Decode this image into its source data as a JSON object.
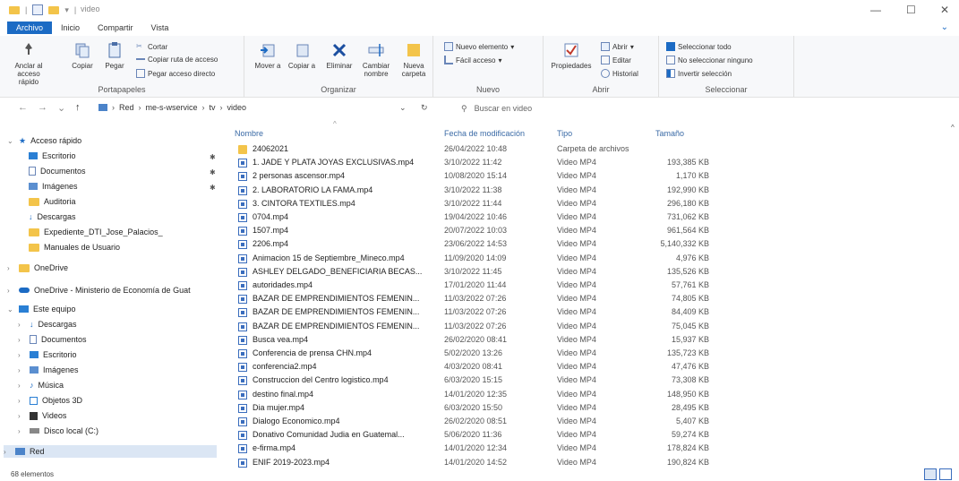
{
  "window": {
    "title": "video",
    "minimize": "—",
    "maximize": "☐",
    "close": "✕"
  },
  "tabs": [
    "Archivo",
    "Inicio",
    "Compartir",
    "Vista"
  ],
  "ribbon": {
    "portapapeles": {
      "label": "Portapapeles",
      "anclar": "Anclar al acceso rápido",
      "copiar": "Copiar",
      "pegar": "Pegar",
      "cortar": "Cortar",
      "copiar_ruta": "Copiar ruta de acceso",
      "pegar_acceso": "Pegar acceso directo"
    },
    "organizar": {
      "label": "Organizar",
      "mover": "Mover a",
      "copiar_a": "Copiar a",
      "eliminar": "Eliminar",
      "cambiar": "Cambiar nombre",
      "nueva": "Nueva carpeta"
    },
    "nuevo": {
      "label": "Nuevo",
      "nuevo_elemento": "Nuevo elemento",
      "facil_acceso": "Fácil acceso"
    },
    "abrir": {
      "label": "Abrir",
      "propiedades": "Propiedades",
      "abrir": "Abrir",
      "editar": "Editar",
      "historial": "Historial"
    },
    "seleccionar": {
      "label": "Seleccionar",
      "todo": "Seleccionar todo",
      "ninguno": "No seleccionar ninguno",
      "invertir": "Invertir selección"
    }
  },
  "address": {
    "crumbs": [
      "Red",
      "me-s-wservice",
      "tv",
      "video"
    ],
    "search_placeholder": "Buscar en video"
  },
  "nav": {
    "quick_access": "Acceso rápido",
    "quick_items": [
      "Escritorio",
      "Documentos",
      "Imágenes",
      "Auditoria",
      "Descargas",
      "Expediente_DTI_Jose_Palacios_",
      "Manuales de Usuario"
    ],
    "onedrive": "OneDrive",
    "onedrive_org": "OneDrive - Ministerio de Economía de Guat",
    "this_pc": "Este equipo",
    "pc_items": [
      "Descargas",
      "Documentos",
      "Escritorio",
      "Imágenes",
      "Música",
      "Objetos 3D",
      "Videos",
      "Disco local (C:)"
    ],
    "red": "Red"
  },
  "columns": {
    "name": "Nombre",
    "date": "Fecha de modificación",
    "type": "Tipo",
    "size": "Tamaño"
  },
  "files": [
    {
      "icon": "folder",
      "name": "24062021",
      "date": "26/04/2022 10:48",
      "type": "Carpeta de archivos",
      "size": ""
    },
    {
      "icon": "video",
      "name": "1. JADE Y PLATA JOYAS EXCLUSIVAS.mp4",
      "date": "3/10/2022 11:42",
      "type": "Video MP4",
      "size": "193,385 KB"
    },
    {
      "icon": "video",
      "name": "2 personas ascensor.mp4",
      "date": "10/08/2020 15:14",
      "type": "Video MP4",
      "size": "1,170 KB"
    },
    {
      "icon": "video",
      "name": "2. LABORATORIO LA FAMA.mp4",
      "date": "3/10/2022 11:38",
      "type": "Video MP4",
      "size": "192,990 KB"
    },
    {
      "icon": "video",
      "name": "3. CINTORA TEXTILES.mp4",
      "date": "3/10/2022 11:44",
      "type": "Video MP4",
      "size": "296,180 KB"
    },
    {
      "icon": "video",
      "name": "0704.mp4",
      "date": "19/04/2022 10:46",
      "type": "Video MP4",
      "size": "731,062 KB"
    },
    {
      "icon": "video",
      "name": "1507.mp4",
      "date": "20/07/2022 10:03",
      "type": "Video MP4",
      "size": "961,564 KB"
    },
    {
      "icon": "video",
      "name": "2206.mp4",
      "date": "23/06/2022 14:53",
      "type": "Video MP4",
      "size": "5,140,332 KB"
    },
    {
      "icon": "video",
      "name": "Animacion 15 de Septiembre_Mineco.mp4",
      "date": "11/09/2020 14:09",
      "type": "Video MP4",
      "size": "4,976 KB"
    },
    {
      "icon": "video",
      "name": "ASHLEY DELGADO_BENEFICIARIA BECAS...",
      "date": "3/10/2022 11:45",
      "type": "Video MP4",
      "size": "135,526 KB"
    },
    {
      "icon": "video",
      "name": "autoridades.mp4",
      "date": "17/01/2020 11:44",
      "type": "Video MP4",
      "size": "57,761 KB"
    },
    {
      "icon": "video",
      "name": "BAZAR DE EMPRENDIMIENTOS FEMENIN...",
      "date": "11/03/2022 07:26",
      "type": "Video MP4",
      "size": "74,805 KB"
    },
    {
      "icon": "video",
      "name": "BAZAR DE EMPRENDIMIENTOS FEMENIN...",
      "date": "11/03/2022 07:26",
      "type": "Video MP4",
      "size": "84,409 KB"
    },
    {
      "icon": "video",
      "name": "BAZAR DE EMPRENDIMIENTOS FEMENIN...",
      "date": "11/03/2022 07:26",
      "type": "Video MP4",
      "size": "75,045 KB"
    },
    {
      "icon": "video",
      "name": "Busca vea.mp4",
      "date": "26/02/2020 08:41",
      "type": "Video MP4",
      "size": "15,937 KB"
    },
    {
      "icon": "video",
      "name": "Conferencia de prensa CHN.mp4",
      "date": "5/02/2020 13:26",
      "type": "Video MP4",
      "size": "135,723 KB"
    },
    {
      "icon": "video",
      "name": "conferencia2.mp4",
      "date": "4/03/2020 08:41",
      "type": "Video MP4",
      "size": "47,476 KB"
    },
    {
      "icon": "video",
      "name": "Construccion del Centro logistico.mp4",
      "date": "6/03/2020 15:15",
      "type": "Video MP4",
      "size": "73,308 KB"
    },
    {
      "icon": "video",
      "name": "destino final.mp4",
      "date": "14/01/2020 12:35",
      "type": "Video MP4",
      "size": "148,950 KB"
    },
    {
      "icon": "video",
      "name": "Dia mujer.mp4",
      "date": "6/03/2020 15:50",
      "type": "Video MP4",
      "size": "28,495 KB"
    },
    {
      "icon": "video",
      "name": "Dialogo Economico.mp4",
      "date": "26/02/2020 08:51",
      "type": "Video MP4",
      "size": "5,407 KB"
    },
    {
      "icon": "video",
      "name": "Donativo Comunidad Judia en Guatemal...",
      "date": "5/06/2020 11:36",
      "type": "Video MP4",
      "size": "59,274 KB"
    },
    {
      "icon": "video",
      "name": "e-firma.mp4",
      "date": "14/01/2020 12:34",
      "type": "Video MP4",
      "size": "178,824 KB"
    },
    {
      "icon": "video",
      "name": "ENIF 2019-2023.mp4",
      "date": "14/01/2020 14:52",
      "type": "Video MP4",
      "size": "190,824 KB"
    }
  ],
  "status": {
    "count": "68 elementos"
  },
  "colors": {
    "accent": "#1c6bc4",
    "folder": "#f3c44a",
    "selection": "#dbe6f4"
  }
}
